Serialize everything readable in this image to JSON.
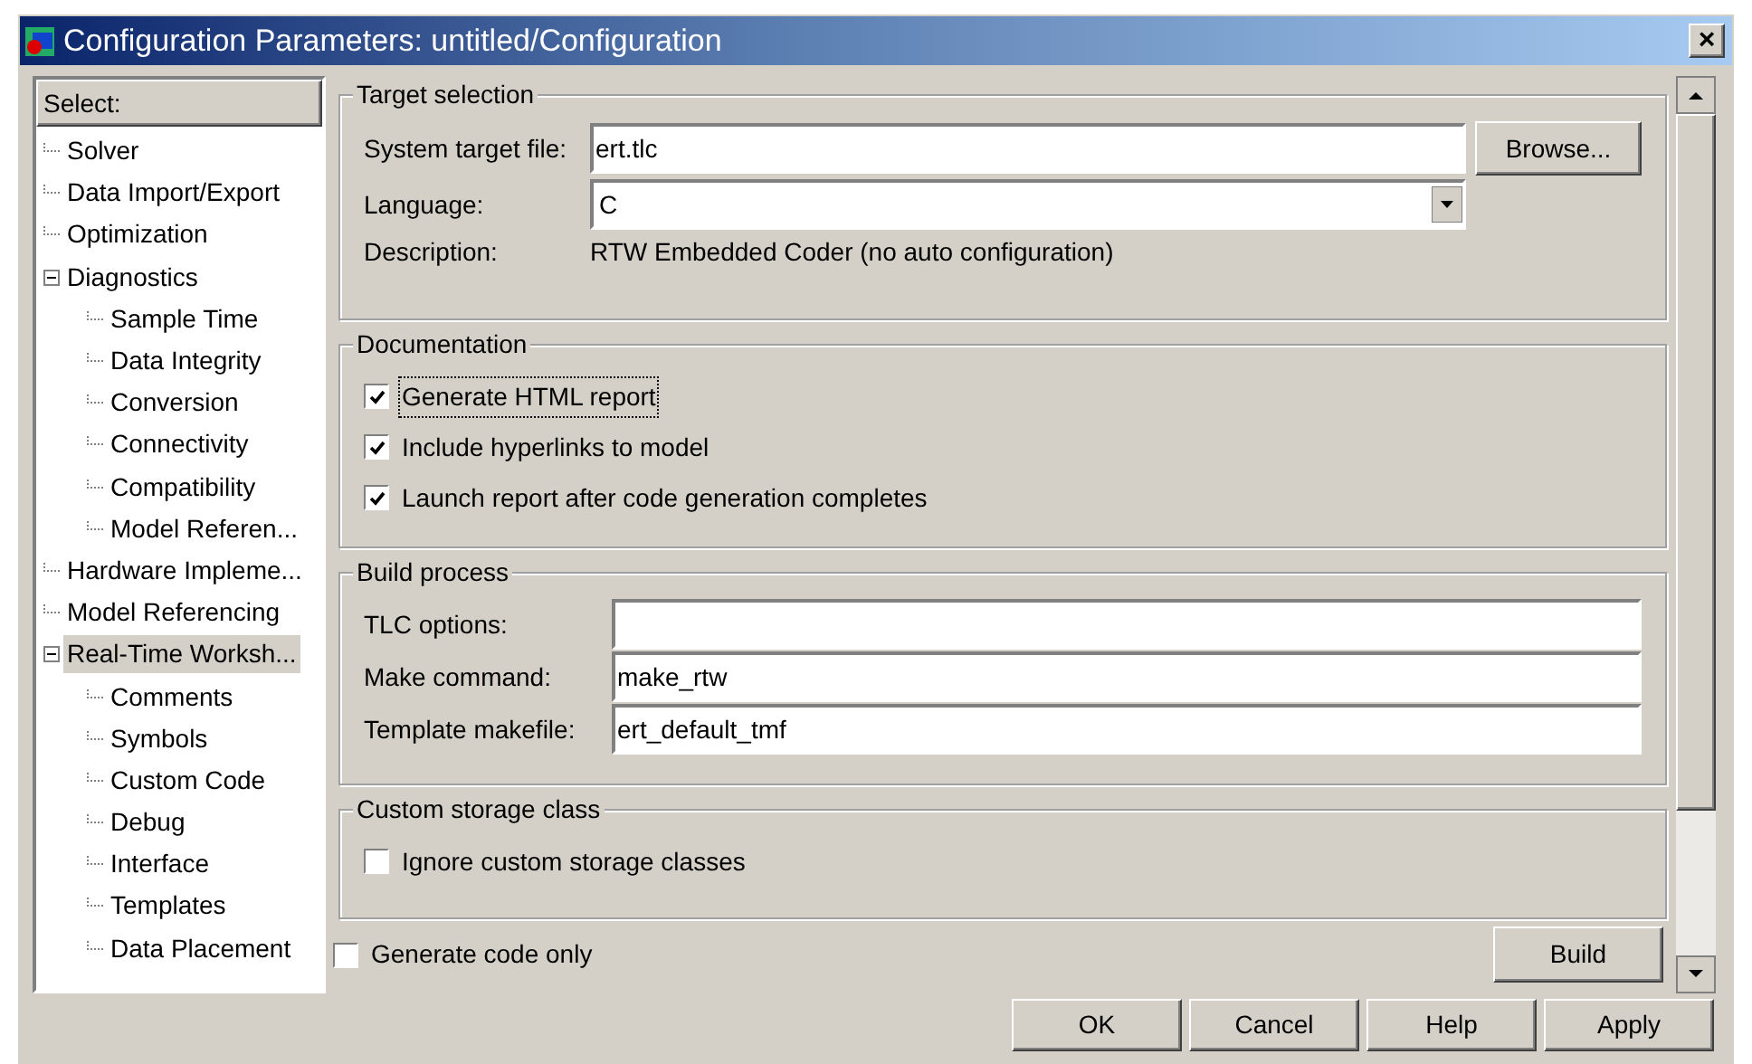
{
  "window": {
    "title": "Configuration Parameters: untitled/Configuration",
    "close": "×"
  },
  "tree": {
    "header": "Select:",
    "items": [
      {
        "label": "Solver",
        "selected": false
      },
      {
        "label": "Data Import/Export",
        "selected": false
      },
      {
        "label": "Optimization",
        "selected": false
      },
      {
        "label": "Diagnostics",
        "selected": false,
        "expanded": true,
        "children": [
          {
            "label": "Sample Time",
            "selected": false
          },
          {
            "label": "Data Integrity",
            "selected": false
          },
          {
            "label": "Conversion",
            "selected": false
          },
          {
            "label": "Connectivity",
            "selected": false
          },
          {
            "label": "Compatibility",
            "selected": false
          },
          {
            "label": "Model Referen...",
            "selected": false
          }
        ]
      },
      {
        "label": "Hardware Impleme...",
        "selected": false
      },
      {
        "label": "Model Referencing",
        "selected": false
      },
      {
        "label": "Real-Time Worksh...",
        "selected": true,
        "expanded": true,
        "children": [
          {
            "label": "Comments",
            "selected": false
          },
          {
            "label": "Symbols",
            "selected": false
          },
          {
            "label": "Custom Code",
            "selected": false
          },
          {
            "label": "Debug",
            "selected": false
          },
          {
            "label": "Interface",
            "selected": false
          },
          {
            "label": "Templates",
            "selected": false
          },
          {
            "label": "Data Placement",
            "selected": false
          }
        ]
      }
    ]
  },
  "target_selection": {
    "title": "Target selection",
    "system_target_file": {
      "label": "System target file:",
      "value": "ert.tlc"
    },
    "browse": "Browse...",
    "language": {
      "label": "Language:",
      "value": "C"
    },
    "description": {
      "label": "Description:",
      "value": "RTW Embedded Coder (no auto configuration)"
    }
  },
  "documentation": {
    "title": "Documentation",
    "options": [
      {
        "label": "Generate HTML report",
        "checked": true,
        "focused": true
      },
      {
        "label": "Include hyperlinks to model",
        "checked": true,
        "focused": false
      },
      {
        "label": "Launch report after code generation completes",
        "checked": true,
        "focused": false
      }
    ]
  },
  "build_process": {
    "title": "Build process",
    "fields": [
      {
        "label": "TLC options:"
      },
      {
        "label": "Make command:",
        "value": "make_rtw"
      },
      {
        "label": "Template makefile:",
        "value": "ert_default_tmf"
      }
    ]
  },
  "custom_storage": {
    "title": "Custom storage class",
    "options": [
      {
        "label": "Ignore custom storage classes",
        "checked": false,
        "focused": false
      }
    ]
  },
  "generate_code_only": {
    "label": "Generate code only",
    "checked": false
  },
  "build_button": "Build",
  "buttons": [
    "OK",
    "Cancel",
    "Help",
    "Apply"
  ]
}
